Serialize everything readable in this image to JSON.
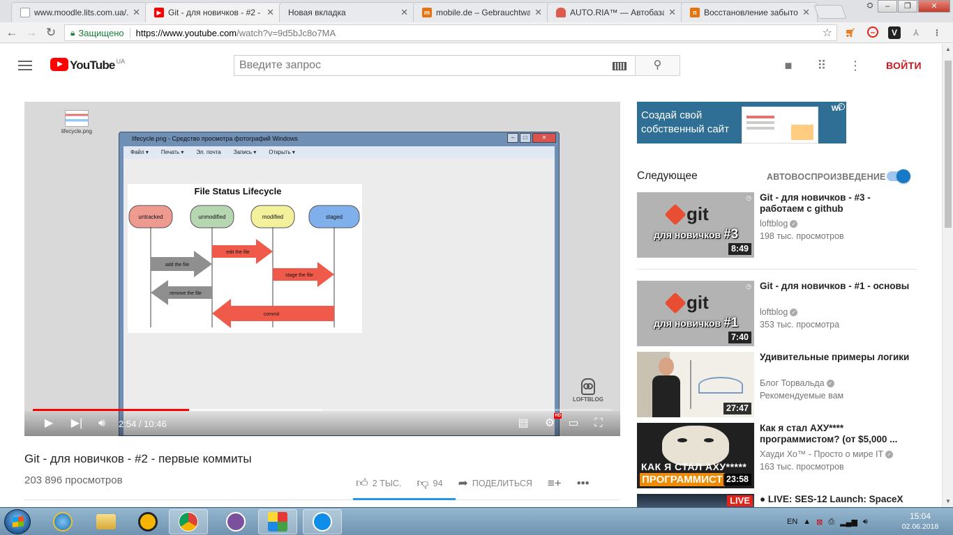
{
  "browser": {
    "tabs": [
      {
        "title": "www.moodle.lits.com.ua/...",
        "favicon_color": "#9aa0a6",
        "active": false
      },
      {
        "title": "Git - для новичков - #2 -",
        "favicon_color": "#ff0000",
        "active": true
      },
      {
        "title": "Новая вкладка",
        "favicon_color": "",
        "active": false
      },
      {
        "title": "mobile.de – Gebrauchtwa",
        "favicon_color": "#e8720c",
        "favicon_text": "m",
        "active": false
      },
      {
        "title": "AUTO.RIA™ — Автобазар",
        "favicon_color": "#db5c4c",
        "active": false
      },
      {
        "title": "Восстановление забытог",
        "favicon_color": "#e8720c",
        "active": false
      }
    ],
    "close_glyph": "✕",
    "secure_label": "Защищено",
    "url_host": "https://www.youtube.com",
    "url_path": "/watch?v=9d5bJc8o7MA"
  },
  "youtube": {
    "logo_text": "YouTube",
    "region": "UA",
    "search_placeholder": "Введите запрос",
    "signin_label": "ВОЙТИ"
  },
  "player": {
    "desktop_icon_label": "lifecycle.png",
    "viewer_title": "lifecycle.png - Средство просмотра фотографий Windows",
    "viewer_menu": [
      "Файл ▾",
      "Печать ▾",
      "Эл. почта",
      "Запись ▾",
      "Открыть ▾"
    ],
    "watermark": "LOFTBLOG",
    "current_time": "2:54",
    "duration": "10:46",
    "time_display": "2:54 / 10:46",
    "progress": 0.27,
    "buffered": 0.5,
    "hd_label": "HD"
  },
  "diagram": {
    "title": "File Status Lifecycle",
    "states": [
      {
        "label": "untracked",
        "color": "#ef9a91"
      },
      {
        "label": "unmodified",
        "color": "#b5d6b0"
      },
      {
        "label": "modified",
        "color": "#f3f19b"
      },
      {
        "label": "staged",
        "color": "#7fb0ec"
      }
    ],
    "transitions": [
      "add the file",
      "edit the file",
      "stage the file",
      "remove the file",
      "commit"
    ]
  },
  "video": {
    "title": "Git - для новичков - #2 - первые коммиты",
    "views": "203 896 просмотров",
    "likes": "2 ТЫС.",
    "dislikes": "94",
    "share_label": "ПОДЕЛИТЬСЯ",
    "like_ratio": 0.96
  },
  "sidebar": {
    "ad": {
      "line1": "Создай свой",
      "line2": "собственный сайт",
      "brand": "Wi"
    },
    "next_label": "Следующее",
    "autoplay_label": "АВТОВОСПРОИЗВЕДЕНИЕ",
    "autoplay_on": true,
    "recommendations": [
      {
        "title": "Git - для новичков - #3 - работаем с github",
        "channel": "loftblog",
        "verified": true,
        "meta": "198 тыс. просмотров",
        "duration": "8:49",
        "thumb": "git",
        "thumb_num": "#3"
      },
      {
        "title": "Git - для новичков - #1 - основы",
        "channel": "loftblog",
        "verified": true,
        "meta": "353 тыс. просмотра",
        "duration": "7:40",
        "thumb": "git",
        "thumb_num": "#1"
      },
      {
        "title": "Удивительные примеры логики",
        "channel": "Блог Торвальда",
        "verified": true,
        "meta": "Рекомендуемые вам",
        "duration": "27:47",
        "thumb": "logic"
      },
      {
        "title": "Как я стал АХУ**** программистом? (от $5,000 ...",
        "channel": "Хауди Хо™ - Просто о мире IT",
        "verified": true,
        "meta": "163 тыс. просмотров",
        "duration": "23:58",
        "thumb": "axy",
        "thumb_line1": "КАК Я СТАЛ АХУ*****",
        "thumb_line2": "ПРОГРАММИСТ"
      },
      {
        "title": "● LIVE: SES-12 Launch: SpaceX",
        "thumb": "live",
        "badge": "LIVE"
      }
    ],
    "git_thumb_word": "git",
    "git_thumb_sub": "для новичков"
  },
  "taskbar": {
    "lang": "EN",
    "time": "15:04",
    "date": "02.06.2018"
  },
  "colors": {
    "yt_red": "#ff0000",
    "signin": "#cc181e",
    "autoplay_blue": "#167ac6",
    "sentiment_blue": "#2793e6"
  }
}
